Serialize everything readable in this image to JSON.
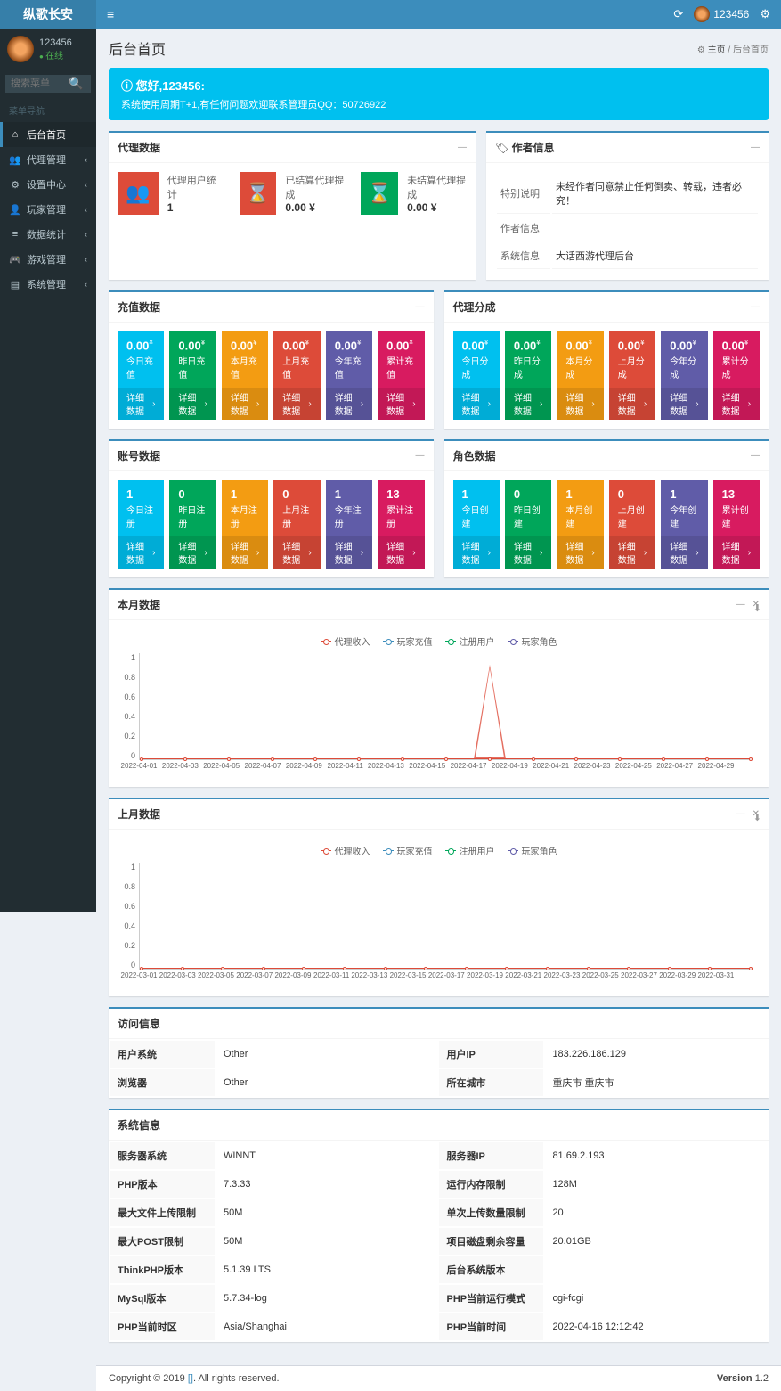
{
  "app": {
    "name": "纵歌长安"
  },
  "user": {
    "name": "123456",
    "status": "在线"
  },
  "search": {
    "placeholder": "搜索菜单"
  },
  "menu": {
    "header": "菜单导航",
    "items": [
      {
        "icon": "⌂",
        "label": "后台首页",
        "active": true,
        "arrow": false
      },
      {
        "icon": "👥",
        "label": "代理管理",
        "arrow": true
      },
      {
        "icon": "⚙",
        "label": "设置中心",
        "arrow": true
      },
      {
        "icon": "👤",
        "label": "玩家管理",
        "arrow": true
      },
      {
        "icon": "≡",
        "label": "数据统计",
        "arrow": true
      },
      {
        "icon": "🎮",
        "label": "游戏管理",
        "arrow": true
      },
      {
        "icon": "▤",
        "label": "系统管理",
        "arrow": true
      }
    ]
  },
  "page": {
    "title": "后台首页",
    "breadcrumb_home": "主页",
    "breadcrumb_current": "后台首页",
    "home_icon": "⚙"
  },
  "callout": {
    "title": "您好,123456:",
    "text": "系统使用周期T+1,有任何问题欢迎联系管理员QQ：50726922"
  },
  "agent_data": {
    "title": "代理数据",
    "items": [
      {
        "icon": "👥",
        "color": "icon-red",
        "label": "代理用户统计",
        "value": "1"
      },
      {
        "icon": "⌛",
        "color": "icon-red",
        "label": "已结算代理提成",
        "value": "0.00 ¥"
      },
      {
        "icon": "⌛",
        "color": "icon-green",
        "label": "未结算代理提成",
        "value": "0.00 ¥"
      }
    ]
  },
  "author": {
    "title": "作者信息",
    "icon": "🏷",
    "rows": [
      {
        "k": "特别说明",
        "v": "未经作者同意禁止任何倒卖、转载，违者必究！"
      },
      {
        "k": "作者信息",
        "v": ""
      },
      {
        "k": "系统信息",
        "v": "大话西游代理后台"
      }
    ]
  },
  "recharge": {
    "title": "充值数据",
    "items": [
      {
        "c": "c-aqua",
        "v": "0.00",
        "s": "¥",
        "l": "今日充值"
      },
      {
        "c": "c-green",
        "v": "0.00",
        "s": "¥",
        "l": "昨日充值"
      },
      {
        "c": "c-yellow",
        "v": "0.00",
        "s": "¥",
        "l": "本月充值"
      },
      {
        "c": "c-red",
        "v": "0.00",
        "s": "¥",
        "l": "上月充值"
      },
      {
        "c": "c-purple",
        "v": "0.00",
        "s": "¥",
        "l": "今年充值"
      },
      {
        "c": "c-maroon",
        "v": "0.00",
        "s": "¥",
        "l": "累计充值"
      }
    ],
    "detail": "详细数据"
  },
  "commission": {
    "title": "代理分成",
    "items": [
      {
        "c": "c-aqua",
        "v": "0.00",
        "s": "¥",
        "l": "今日分成"
      },
      {
        "c": "c-green",
        "v": "0.00",
        "s": "¥",
        "l": "昨日分成"
      },
      {
        "c": "c-yellow",
        "v": "0.00",
        "s": "¥",
        "l": "本月分成"
      },
      {
        "c": "c-red",
        "v": "0.00",
        "s": "¥",
        "l": "上月分成"
      },
      {
        "c": "c-purple",
        "v": "0.00",
        "s": "¥",
        "l": "今年分成"
      },
      {
        "c": "c-maroon",
        "v": "0.00",
        "s": "¥",
        "l": "累计分成"
      }
    ]
  },
  "account": {
    "title": "账号数据",
    "items": [
      {
        "c": "c-aqua",
        "v": "1",
        "l": "今日注册"
      },
      {
        "c": "c-green",
        "v": "0",
        "l": "昨日注册"
      },
      {
        "c": "c-yellow",
        "v": "1",
        "l": "本月注册"
      },
      {
        "c": "c-red",
        "v": "0",
        "l": "上月注册"
      },
      {
        "c": "c-purple",
        "v": "1",
        "l": "今年注册"
      },
      {
        "c": "c-maroon",
        "v": "13",
        "l": "累计注册"
      }
    ]
  },
  "role": {
    "title": "角色数据",
    "items": [
      {
        "c": "c-aqua",
        "v": "1",
        "l": "今日创建"
      },
      {
        "c": "c-green",
        "v": "0",
        "l": "昨日创建"
      },
      {
        "c": "c-yellow",
        "v": "1",
        "l": "本月创建"
      },
      {
        "c": "c-red",
        "v": "0",
        "l": "上月创建"
      },
      {
        "c": "c-purple",
        "v": "1",
        "l": "今年创建"
      },
      {
        "c": "c-maroon",
        "v": "13",
        "l": "累计创建"
      }
    ]
  },
  "chart_data": [
    {
      "title": "本月数据",
      "type": "line",
      "legend": [
        "代理收入",
        "玩家充值",
        "注册用户",
        "玩家角色"
      ],
      "legend_colors": [
        "#dd4b39",
        "#3c8dbc",
        "#00a65a",
        "#605ca8"
      ],
      "y_ticks": [
        "1",
        "0.8",
        "0.6",
        "0.4",
        "0.2",
        "0"
      ],
      "x_ticks": [
        "2022-04-01",
        "2022-04-03",
        "2022-04-05",
        "2022-04-07",
        "2022-04-09",
        "2022-04-11",
        "2022-04-13",
        "2022-04-15",
        "2022-04-17",
        "2022-04-19",
        "2022-04-21",
        "2022-04-23",
        "2022-04-25",
        "2022-04-27",
        "2022-04-29"
      ],
      "ylim": [
        0,
        1
      ],
      "series": [
        {
          "name": "代理收入",
          "values": [
            0,
            0,
            0,
            0,
            0,
            0,
            0,
            0,
            1,
            0,
            0,
            0,
            0,
            0,
            0
          ]
        },
        {
          "name": "玩家充值",
          "values": [
            0,
            0,
            0,
            0,
            0,
            0,
            0,
            0,
            0,
            0,
            0,
            0,
            0,
            0,
            0
          ]
        },
        {
          "name": "注册用户",
          "values": [
            0,
            0,
            0,
            0,
            0,
            0,
            0,
            0,
            1,
            0,
            0,
            0,
            0,
            0,
            0
          ]
        },
        {
          "name": "玩家角色",
          "values": [
            0,
            0,
            0,
            0,
            0,
            0,
            0,
            0,
            1,
            0,
            0,
            0,
            0,
            0,
            0
          ]
        }
      ]
    },
    {
      "title": "上月数据",
      "type": "line",
      "legend": [
        "代理收入",
        "玩家充值",
        "注册用户",
        "玩家角色"
      ],
      "legend_colors": [
        "#dd4b39",
        "#3c8dbc",
        "#00a65a",
        "#605ca8"
      ],
      "y_ticks": [
        "1",
        "0.8",
        "0.6",
        "0.4",
        "0.2",
        "0"
      ],
      "x_ticks": [
        "2022-03-01",
        "2022-03-03",
        "2022-03-05",
        "2022-03-07",
        "2022-03-09",
        "2022-03-11",
        "2022-03-13",
        "2022-03-15",
        "2022-03-17",
        "2022-03-19",
        "2022-03-21",
        "2022-03-23",
        "2022-03-25",
        "2022-03-27",
        "2022-03-29",
        "2022-03-31"
      ],
      "ylim": [
        0,
        1
      ],
      "series": [
        {
          "name": "代理收入",
          "values": [
            0,
            0,
            0,
            0,
            0,
            0,
            0,
            0,
            0,
            0,
            0,
            0,
            0,
            0,
            0,
            0
          ]
        },
        {
          "name": "玩家充值",
          "values": [
            0,
            0,
            0,
            0,
            0,
            0,
            0,
            0,
            0,
            0,
            0,
            0,
            0,
            0,
            0,
            0
          ]
        },
        {
          "name": "注册用户",
          "values": [
            0,
            0,
            0,
            0,
            0,
            0,
            0,
            0,
            0,
            0,
            0,
            0,
            0,
            0,
            0,
            0
          ]
        },
        {
          "name": "玩家角色",
          "values": [
            0,
            0,
            0,
            0,
            0,
            0,
            0,
            0,
            0,
            0,
            0,
            0,
            0,
            0,
            0,
            0
          ]
        }
      ]
    }
  ],
  "visit": {
    "title": "访问信息",
    "rows": [
      {
        "k1": "用户系统",
        "v1": "Other",
        "k2": "用户IP",
        "v2": "183.226.186.129"
      },
      {
        "k1": "浏览器",
        "v1": "Other",
        "k2": "所在城市",
        "v2": "重庆市 重庆市"
      }
    ]
  },
  "system": {
    "title": "系统信息",
    "rows": [
      {
        "k1": "服务器系统",
        "v1": "WINNT",
        "k2": "服务器IP",
        "v2": "81.69.2.193"
      },
      {
        "k1": "PHP版本",
        "v1": "7.3.33",
        "k2": "运行内存限制",
        "v2": "128M"
      },
      {
        "k1": "最大文件上传限制",
        "v1": "50M",
        "k2": "单次上传数量限制",
        "v2": "20"
      },
      {
        "k1": "最大POST限制",
        "v1": "50M",
        "k2": "项目磁盘剩余容量",
        "v2": "20.01GB"
      },
      {
        "k1": "ThinkPHP版本",
        "v1": "5.1.39 LTS",
        "k2": "后台系统版本",
        "v2": ""
      },
      {
        "k1": "MySql版本",
        "v1": "5.7.34-log",
        "k2": "PHP当前运行模式",
        "v2": "cgi-fcgi"
      },
      {
        "k1": "PHP当前时区",
        "v1": "Asia/Shanghai",
        "k2": "PHP当前时间",
        "v2": "2022-04-16 12:12:42"
      }
    ]
  },
  "footer": {
    "copyright": "Copyright © 2019 ",
    "link": "[]",
    "rights": ". All rights reserved.",
    "version_label": "Version ",
    "version": "1.2"
  }
}
